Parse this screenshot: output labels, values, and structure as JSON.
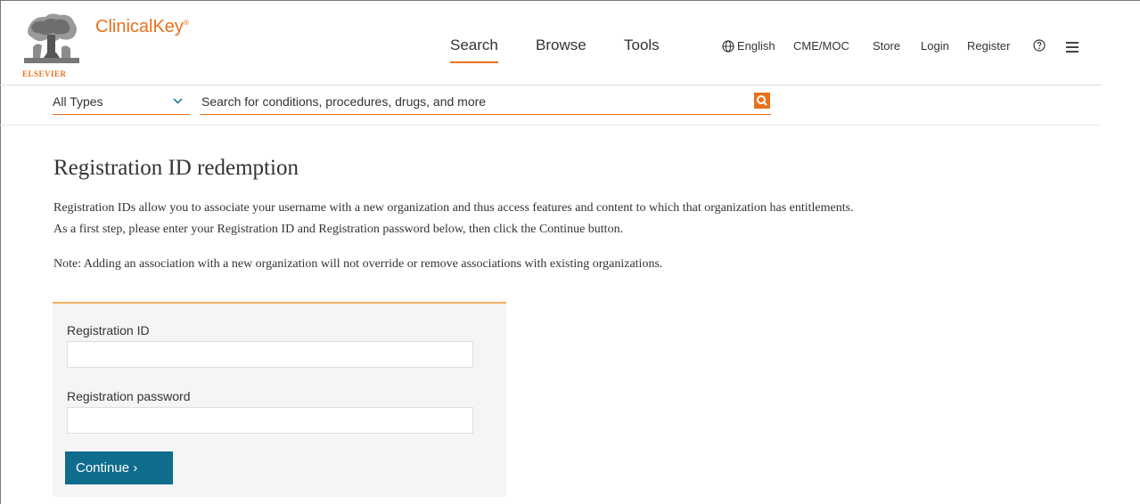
{
  "brand": {
    "publisher": "ELSEVIER",
    "name": "ClinicalKey",
    "mark": "®",
    "accent_color": "#e9711c"
  },
  "nav": {
    "tabs": [
      {
        "label": "Search",
        "active": true
      },
      {
        "label": "Browse",
        "active": false
      },
      {
        "label": "Tools",
        "active": false
      }
    ]
  },
  "utility": {
    "language": "English",
    "cme": "CME/MOC",
    "store": "Store",
    "login": "Login",
    "register": "Register",
    "help_icon": "help-circle-icon",
    "menu_icon": "hamburger-menu-icon"
  },
  "search": {
    "type_selected": "All Types",
    "placeholder": "Search for conditions, procedures, drugs, and more",
    "value": ""
  },
  "page": {
    "title": "Registration ID redemption",
    "paragraph_line1": "Registration IDs allow you to associate your username with a new organization and thus access features and content to which that organization has entitlements.",
    "paragraph_line2": "As a first step, please enter your Registration ID and Registration password below, then click the Continue button.",
    "note": "Note: Adding an association with a new organization will not override or remove associations with existing organizations."
  },
  "form": {
    "id_label": "Registration ID",
    "id_value": "",
    "password_label": "Registration password",
    "password_value": "",
    "continue_label": "Continue ›",
    "button_color": "#0f6c8d"
  }
}
